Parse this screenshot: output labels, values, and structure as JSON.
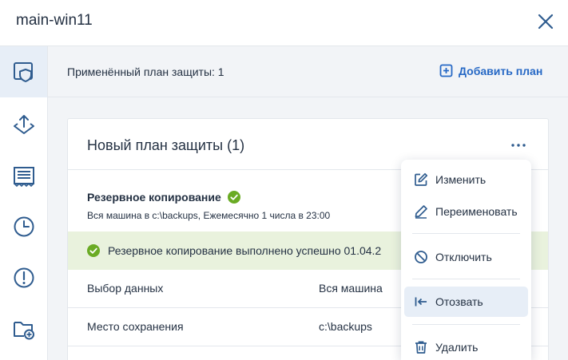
{
  "window": {
    "title": "main-win11"
  },
  "topbar": {
    "applied_label": "Применённый план защиты: 1",
    "add_plan_label": "Добавить план"
  },
  "card": {
    "title": "Новый план защиты (1)",
    "backup": {
      "title": "Резервное копирование",
      "subtitle": "Вся машина в c:\\backups, Ежемесячно 1 числа в 23:00"
    },
    "status": "Резервное копирование выполнено успешно 01.04.2",
    "rows": [
      {
        "key": "Выбор данных",
        "value": "Вся машина"
      },
      {
        "key": "Место сохранения",
        "value": "c:\\backups"
      }
    ]
  },
  "menu": {
    "items": [
      {
        "label": "Изменить",
        "icon": "edit-icon"
      },
      {
        "label": "Переименовать",
        "icon": "pencil-icon"
      },
      {
        "label": "Отключить",
        "icon": "disable-icon"
      },
      {
        "label": "Отозвать",
        "icon": "revoke-icon"
      },
      {
        "label": "Удалить",
        "icon": "trash-icon"
      }
    ]
  },
  "colors": {
    "accent": "#2668c5",
    "icon": "#2f5c8f",
    "success": "#6aab24",
    "success_bg": "#e9f2dd"
  }
}
